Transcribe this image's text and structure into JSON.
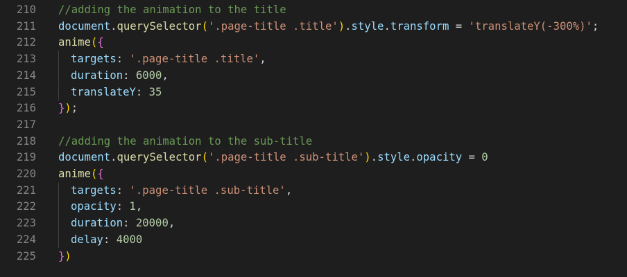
{
  "lines": [
    {
      "num": "210",
      "tokens": [
        {
          "t": "//adding the animation to the title",
          "c": "com"
        }
      ]
    },
    {
      "num": "211",
      "tokens": [
        {
          "t": "document",
          "c": "var"
        },
        {
          "t": ".",
          "c": "op"
        },
        {
          "t": "querySelector",
          "c": "fn"
        },
        {
          "t": "(",
          "c": "b1"
        },
        {
          "t": "'.page-title .title'",
          "c": "str"
        },
        {
          "t": ")",
          "c": "b1"
        },
        {
          "t": ".",
          "c": "op"
        },
        {
          "t": "style",
          "c": "var"
        },
        {
          "t": ".",
          "c": "op"
        },
        {
          "t": "transform",
          "c": "var"
        },
        {
          "t": " = ",
          "c": "op"
        },
        {
          "t": "'translateY(-300%)'",
          "c": "str"
        },
        {
          "t": ";",
          "c": "op"
        }
      ]
    },
    {
      "num": "212",
      "tokens": [
        {
          "t": "anime",
          "c": "fn"
        },
        {
          "t": "(",
          "c": "b1"
        },
        {
          "t": "{",
          "c": "b2"
        }
      ]
    },
    {
      "num": "213",
      "indent": true,
      "tokens": [
        {
          "t": "targets",
          "c": "var"
        },
        {
          "t": ": ",
          "c": "op"
        },
        {
          "t": "'.page-title .title'",
          "c": "str"
        },
        {
          "t": ",",
          "c": "op"
        }
      ]
    },
    {
      "num": "214",
      "indent": true,
      "tokens": [
        {
          "t": "duration",
          "c": "var"
        },
        {
          "t": ": ",
          "c": "op"
        },
        {
          "t": "6000",
          "c": "num"
        },
        {
          "t": ",",
          "c": "op"
        }
      ]
    },
    {
      "num": "215",
      "indent": true,
      "tokens": [
        {
          "t": "translateY",
          "c": "var"
        },
        {
          "t": ": ",
          "c": "op"
        },
        {
          "t": "35",
          "c": "num"
        }
      ]
    },
    {
      "num": "216",
      "tokens": [
        {
          "t": "}",
          "c": "b2"
        },
        {
          "t": ")",
          "c": "b1"
        },
        {
          "t": ";",
          "c": "op"
        }
      ]
    },
    {
      "num": "217",
      "tokens": []
    },
    {
      "num": "218",
      "tokens": [
        {
          "t": "//adding the animation to the sub-title",
          "c": "com"
        }
      ]
    },
    {
      "num": "219",
      "tokens": [
        {
          "t": "document",
          "c": "var"
        },
        {
          "t": ".",
          "c": "op"
        },
        {
          "t": "querySelector",
          "c": "fn"
        },
        {
          "t": "(",
          "c": "b1"
        },
        {
          "t": "'.page-title .sub-title'",
          "c": "str"
        },
        {
          "t": ")",
          "c": "b1"
        },
        {
          "t": ".",
          "c": "op"
        },
        {
          "t": "style",
          "c": "var"
        },
        {
          "t": ".",
          "c": "op"
        },
        {
          "t": "opacity",
          "c": "var"
        },
        {
          "t": " = ",
          "c": "op"
        },
        {
          "t": "0",
          "c": "num"
        }
      ]
    },
    {
      "num": "220",
      "tokens": [
        {
          "t": "anime",
          "c": "fn"
        },
        {
          "t": "(",
          "c": "b1"
        },
        {
          "t": "{",
          "c": "b2"
        }
      ]
    },
    {
      "num": "221",
      "indent": true,
      "tokens": [
        {
          "t": "targets",
          "c": "var"
        },
        {
          "t": ": ",
          "c": "op"
        },
        {
          "t": "'.page-title .sub-title'",
          "c": "str"
        },
        {
          "t": ",",
          "c": "op"
        }
      ]
    },
    {
      "num": "222",
      "indent": true,
      "tokens": [
        {
          "t": "opacity",
          "c": "var"
        },
        {
          "t": ": ",
          "c": "op"
        },
        {
          "t": "1",
          "c": "num"
        },
        {
          "t": ",",
          "c": "op"
        }
      ]
    },
    {
      "num": "223",
      "indent": true,
      "tokens": [
        {
          "t": "duration",
          "c": "var"
        },
        {
          "t": ": ",
          "c": "op"
        },
        {
          "t": "20000",
          "c": "num"
        },
        {
          "t": ",",
          "c": "op"
        }
      ]
    },
    {
      "num": "224",
      "indent": true,
      "tokens": [
        {
          "t": "delay",
          "c": "var"
        },
        {
          "t": ": ",
          "c": "op"
        },
        {
          "t": "4000",
          "c": "num"
        }
      ]
    },
    {
      "num": "225",
      "tokens": [
        {
          "t": "}",
          "c": "b2"
        },
        {
          "t": ")",
          "c": "b1"
        }
      ]
    }
  ],
  "theme": {
    "background": "#1e1e1e",
    "line_number": "#858585",
    "comment": "#6a9955",
    "variable": "#9cdcfe",
    "function": "#dcdcaa",
    "string": "#ce9178",
    "number": "#b5cea8",
    "bracket_level1": "#ffd700",
    "bracket_level2": "#da70d6",
    "indent_guide": "#404040"
  }
}
